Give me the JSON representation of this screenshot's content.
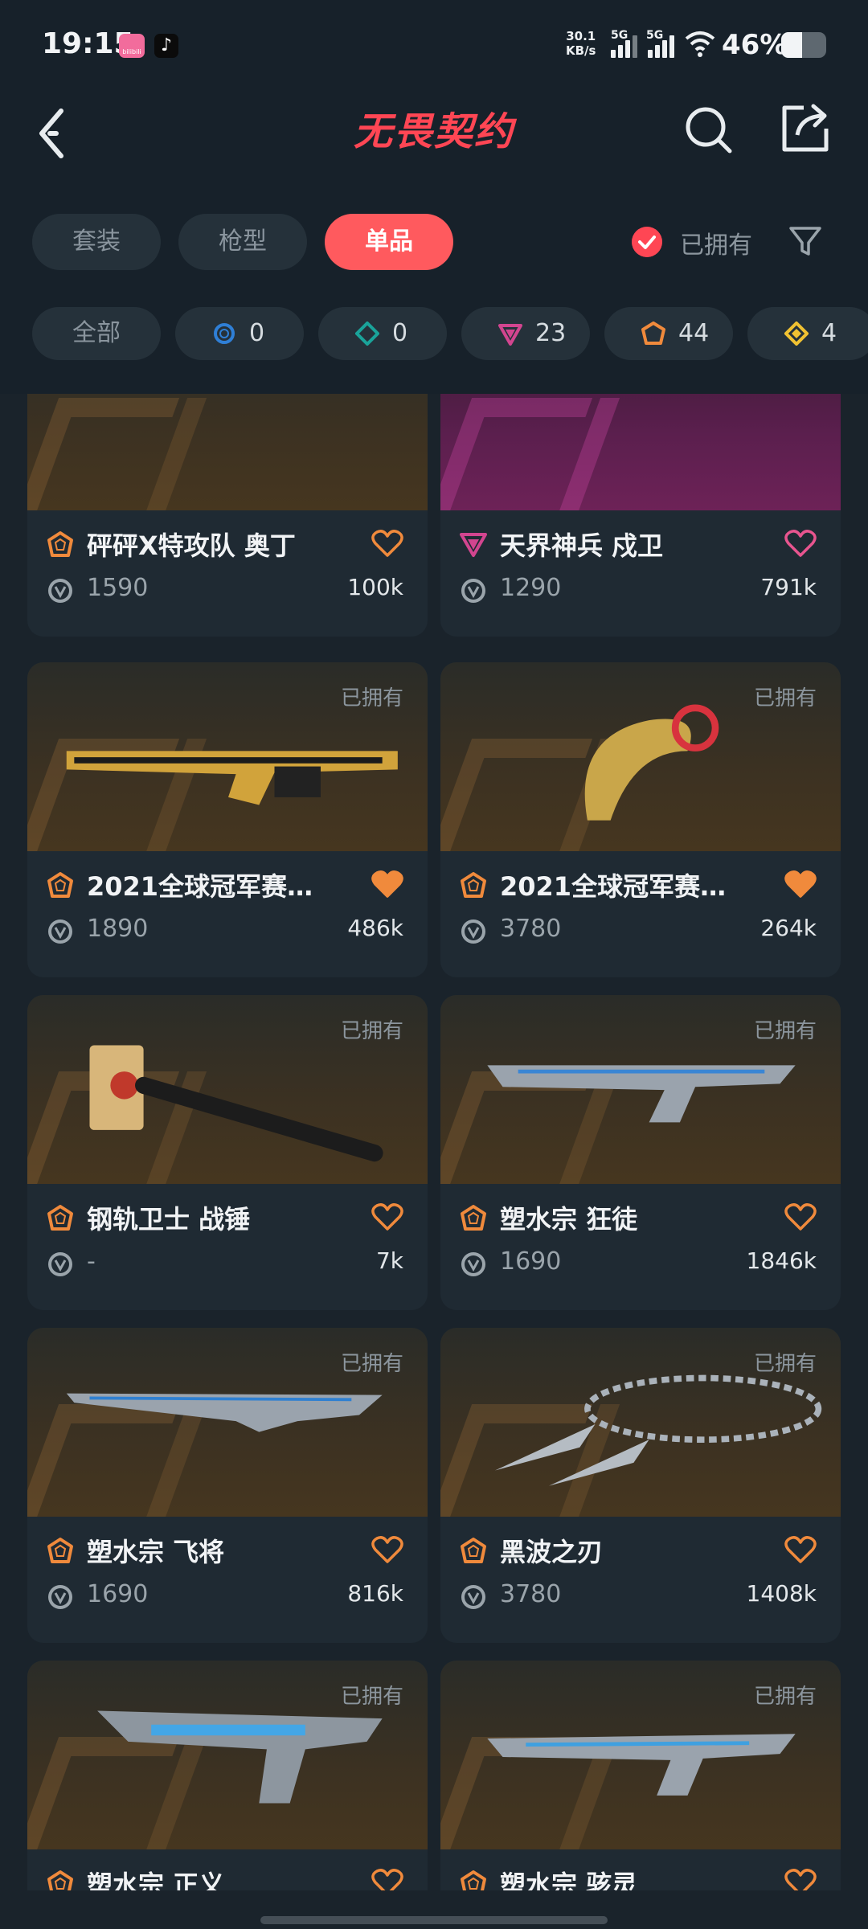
{
  "status_bar": {
    "time": "19:15",
    "app1_label": "bilibili",
    "net_speed_value": "30.1",
    "net_speed_unit": "KB/s",
    "sim1_label": "5G",
    "sim2_label": "5G",
    "battery_percent": "46%",
    "battery_level": 0.46
  },
  "header": {
    "app_title": "无畏契约",
    "icons": {
      "back": "back-icon",
      "search": "search-icon",
      "share": "share-icon"
    }
  },
  "tabs": [
    {
      "label": "套装",
      "active": false
    },
    {
      "label": "枪型",
      "active": false
    },
    {
      "label": "单品",
      "active": true
    }
  ],
  "owned_filter": {
    "label": "已拥有",
    "checked": true
  },
  "rarity_chips": [
    {
      "label": "全部"
    },
    {
      "icon": "select-tier-icon",
      "color": "#2f7fd6",
      "count": "0"
    },
    {
      "icon": "deluxe-tier-icon",
      "color": "#1aa39a",
      "count": "0"
    },
    {
      "icon": "premium-tier-icon",
      "color": "#d2458f",
      "count": "23"
    },
    {
      "icon": "exclusive-tier-icon",
      "color": "#f08a3c",
      "count": "44"
    },
    {
      "icon": "ultra-tier-icon",
      "color": "#f1c232",
      "count": "4"
    }
  ],
  "colors": {
    "accent": "#ff4654",
    "tier_exclusive": "#f08a3c",
    "tier_premium": "#d2458f",
    "heart_pink": "#e8558f"
  },
  "owned_tag": "已拥有",
  "skins": [
    {
      "name": "砰砰X特攻队 奥丁",
      "tier": "exclusive",
      "price": "1590",
      "likes": "100k",
      "liked": false,
      "owned": false
    },
    {
      "name": "天界神兵 戍卫",
      "tier": "premium",
      "price": "1290",
      "likes": "791k",
      "liked": false,
      "owned": false
    },
    {
      "name": "2021全球冠军赛…",
      "tier": "exclusive",
      "price": "1890",
      "likes": "486k",
      "liked": true,
      "owned": true
    },
    {
      "name": "2021全球冠军赛…",
      "tier": "exclusive",
      "price": "3780",
      "likes": "264k",
      "liked": true,
      "owned": true
    },
    {
      "name": "钢轨卫士 战锤",
      "tier": "exclusive",
      "price": "-",
      "likes": "7k",
      "liked": false,
      "owned": true
    },
    {
      "name": "塑水宗 狂徒",
      "tier": "exclusive",
      "price": "1690",
      "likes": "1846k",
      "liked": false,
      "owned": true
    },
    {
      "name": "塑水宗 飞将",
      "tier": "exclusive",
      "price": "1690",
      "likes": "816k",
      "liked": false,
      "owned": true
    },
    {
      "name": "黑波之刃",
      "tier": "exclusive",
      "price": "3780",
      "likes": "1408k",
      "liked": false,
      "owned": true
    },
    {
      "name": "塑水宗 正义",
      "tier": "exclusive",
      "price": "",
      "likes": "",
      "liked": false,
      "owned": true
    },
    {
      "name": "塑水宗 骇灵",
      "tier": "exclusive",
      "price": "",
      "likes": "",
      "liked": false,
      "owned": true
    }
  ]
}
